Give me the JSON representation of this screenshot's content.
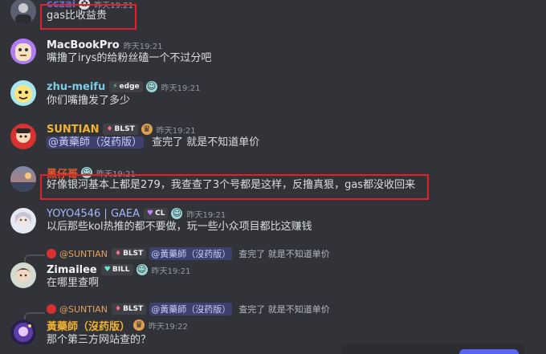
{
  "messages": [
    {
      "name": "cczai",
      "time": "昨天19:21",
      "text": "gas比收益贵",
      "name_color": "#f2f3f5"
    },
    {
      "name": "MacBookPro",
      "time": "昨天19:21",
      "text": "嘴撸了irys的给粉丝磕一个不过分吧",
      "name_color": "#f2f3f5"
    },
    {
      "name": "zhu-meifu",
      "badge": "edge",
      "time": "昨天19:21",
      "text": "你们嘴撸发了多少",
      "name_color": "#7ec8e3"
    },
    {
      "name": "SUNTIAN",
      "badge": "BLST",
      "time": "昨天19:21",
      "mention": "@黃藥師（沒药版）",
      "text": "查完了 就是不知道单价",
      "name_color": "#f0b232"
    },
    {
      "name": "黑仔哥",
      "time": "昨天19:21",
      "text": "好像银河基本上都是279，我查查了3个号都是这样，反撸真狠，gas都没收回来",
      "name_color": "#e05a2b"
    },
    {
      "name": "YOYO4546 | GAEA",
      "badge": "CL",
      "time": "昨天19:21",
      "text": "以后那些kol热推的都不要做，玩一些小众项目都比这赚钱",
      "name_color": "#a5b4fc"
    },
    {
      "reply_name": "@SUNTIAN",
      "reply_badge": "BLST",
      "reply_mention": "@黃藥師（沒药版）",
      "reply_text": "查完了 就是不知道单价",
      "name": "Zimailee",
      "badge": "BILL",
      "time": "昨天19:21",
      "text": "在哪里查啊",
      "name_color": "#f2f3f5"
    },
    {
      "reply_name": "@SUNTIAN",
      "reply_badge": "BLST",
      "reply_mention": "@黃藥師（沒药版）",
      "reply_text": "查完了 就是不知道单价",
      "name": "黃藥師（沒药版）",
      "time": "昨天19:22",
      "text": "那个第三方网站查的？",
      "name_color": "#f0b232"
    }
  ],
  "colors": {
    "background": "#313338",
    "highlight_box": "#e0202a",
    "mention_bg": "#5865f2"
  }
}
